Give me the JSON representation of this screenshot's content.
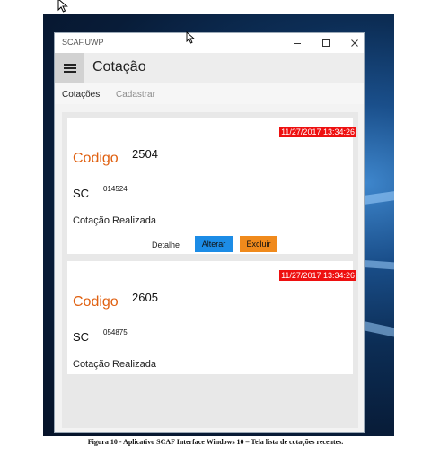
{
  "window": {
    "title": "SCAF.UWP"
  },
  "appbar": {
    "title": "Cotação"
  },
  "tabs": [
    {
      "label": "Cotações"
    },
    {
      "label": "Cadastrar"
    }
  ],
  "cards": [
    {
      "date": "11/27/2017 13:34:26",
      "codigo_label": "Codigo",
      "codigo": "2504",
      "sc_label": "SC",
      "sc": "014524",
      "status": "Cotação Realizada",
      "actions": {
        "detalhe": "Detalhe",
        "alterar": "Alterar",
        "excluir": "Excluir"
      }
    },
    {
      "date": "11/27/2017 13:34:26",
      "codigo_label": "Codigo",
      "codigo": "2605",
      "sc_label": "SC",
      "sc": "054875",
      "status": "Cotação Realizada"
    }
  ],
  "colors": {
    "accent_orange": "#e06010",
    "date_red": "#ee1010",
    "alterar_blue": "#1c8ce6",
    "excluir_orange": "#f08a1c"
  },
  "icons": [
    "mouse-cursor-icon",
    "minimize-icon",
    "maximize-icon",
    "close-icon",
    "hamburger-menu-icon"
  ],
  "caption": "Figura 10 - Aplicativo SCAF Interface Windows 10 – Tela lista de cotações recentes."
}
